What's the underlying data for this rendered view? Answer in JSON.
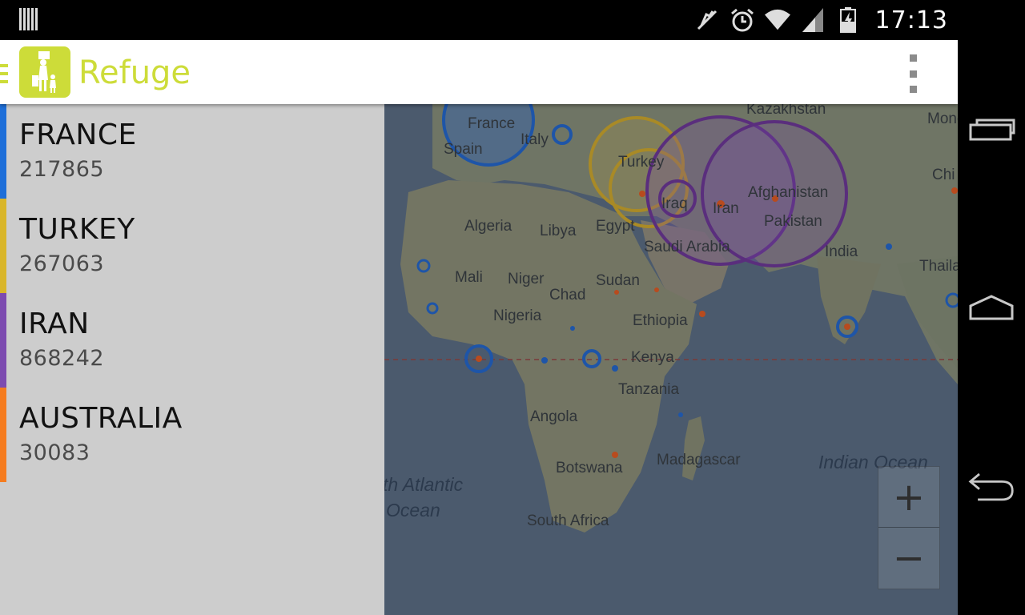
{
  "status": {
    "time": "17:13",
    "left_icon": "barcode-notification-icon",
    "icons": [
      "mute-icon",
      "alarm-icon",
      "wifi-icon",
      "signal-icon",
      "battery-charging-icon"
    ]
  },
  "app": {
    "title": "Refuge",
    "logo_icon": "refuge-family-logo-icon",
    "accent_color": "#cddc39"
  },
  "drawer": {
    "items": [
      {
        "name": "FRANCE",
        "count": "217865",
        "color": "#1e6fd9"
      },
      {
        "name": "TURKEY",
        "count": "267063",
        "color": "#d9b62a"
      },
      {
        "name": "IRAN",
        "count": "868242",
        "color": "#7d4bb0"
      },
      {
        "name": "AUSTRALIA",
        "count": "30083",
        "color": "#f57c1f"
      }
    ]
  },
  "map": {
    "labels": {
      "kazakhstan": "Kazakhstan",
      "mongolia": "Mongo",
      "france": "France",
      "spain": "Spain",
      "italy": "Italy",
      "turkey": "Turkey",
      "iraq": "Iraq",
      "iran": "Iran",
      "afghanistan": "Afghanistan",
      "pakistan": "Pakistan",
      "china": "Chi",
      "algeria": "Algeria",
      "libya": "Libya",
      "egypt": "Egypt",
      "saudi_arabia": "Saudi Arabia",
      "india": "India",
      "thailand": "Thailan",
      "mali": "Mali",
      "niger": "Niger",
      "chad": "Chad",
      "sudan": "Sudan",
      "nigeria": "Nigeria",
      "ethiopia": "Ethiopia",
      "kenya": "Kenya",
      "tanzania": "Tanzania",
      "angola": "Angola",
      "madagascar": "Madagascar",
      "botswana": "Botswana",
      "south_africa": "South Africa",
      "indian_ocean": "Indian Ocean",
      "atlantic_1": "th Atlantic",
      "atlantic_2": "Ocean"
    },
    "zoom_in": "+",
    "zoom_out": "−"
  },
  "nav": {
    "recents": "recent-apps-icon",
    "home": "home-icon",
    "back": "back-icon"
  }
}
